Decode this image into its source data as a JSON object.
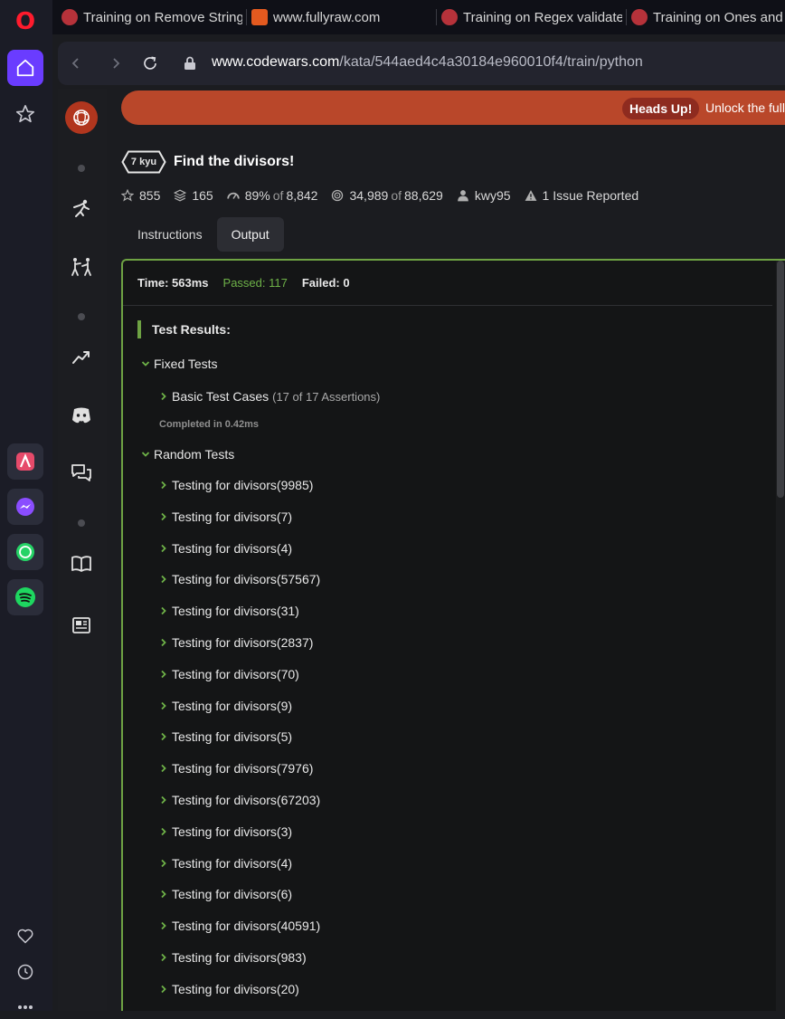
{
  "browser": {
    "tabs": [
      {
        "title": "Training on Remove String"
      },
      {
        "title": "www.fullyraw.com"
      },
      {
        "title": "Training on Regex validate"
      },
      {
        "title": "Training on Ones and"
      }
    ],
    "url_domain": "www.codewars.com",
    "url_path": "/kata/544aed4c4a30184e960010f4/train/python"
  },
  "banner": {
    "badge": "Heads Up!",
    "text": "Unlock the full po"
  },
  "kata": {
    "rank": "7 kyu",
    "title": "Find the divisors!",
    "stars": "855",
    "collections": "165",
    "satisfaction_pct": "89%",
    "satisfaction_of": "of",
    "satisfaction_total": "8,842",
    "completed": "34,989",
    "completed_of": "of",
    "completed_total": "88,629",
    "author": "kwy95",
    "issues": "1 Issue Reported"
  },
  "tabs": {
    "instructions": "Instructions",
    "output": "Output"
  },
  "output": {
    "time": "Time: 563ms",
    "passed": "Passed: 117",
    "failed": "Failed: 0",
    "results_heading": "Test Results:",
    "fixed_group": "Fixed Tests",
    "basic_label": "Basic Test Cases",
    "basic_assertions": "(17 of 17 Assertions)",
    "completed_note": "Completed in 0.42ms",
    "random_group": "Random Tests",
    "random_items": [
      "Testing for divisors(9985)",
      "Testing for divisors(7)",
      "Testing for divisors(4)",
      "Testing for divisors(57567)",
      "Testing for divisors(31)",
      "Testing for divisors(2837)",
      "Testing for divisors(70)",
      "Testing for divisors(9)",
      "Testing for divisors(5)",
      "Testing for divisors(7976)",
      "Testing for divisors(67203)",
      "Testing for divisors(3)",
      "Testing for divisors(4)",
      "Testing for divisors(6)",
      "Testing for divisors(40591)",
      "Testing for divisors(983)",
      "Testing for divisors(20)"
    ]
  },
  "colors": {
    "accent_green": "#6ea243",
    "banner_red": "#b9472a",
    "codewars_red": "#b1361e",
    "opera_accent": "#6a3cff"
  },
  "icons": {
    "sidebar": [
      "codewars-logo-icon",
      "practice-icon",
      "dojo-icon",
      "leaderboard-icon",
      "discord-icon",
      "chat-icon",
      "docs-icon",
      "news-icon"
    ]
  }
}
